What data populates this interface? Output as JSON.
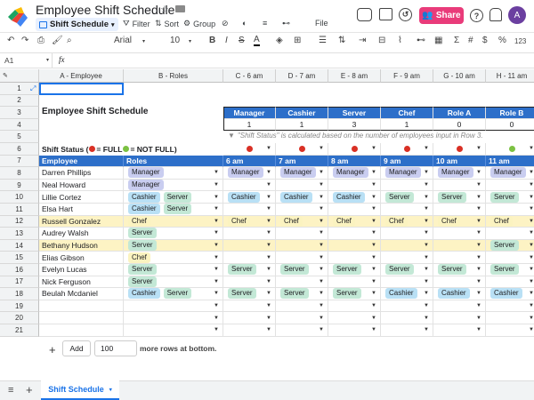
{
  "app": {
    "doc_title": "Employee Shift Schedule",
    "view_name": "Shift Schedule",
    "menu": {
      "filter": "Filter",
      "sort": "Sort",
      "group": "Group",
      "file": "File"
    },
    "share_label": "Share",
    "avatar_initial": "A"
  },
  "toolbar": {
    "font": "Arial",
    "font_size": "10",
    "percent": "%",
    "dollar": "$",
    "format_more": "123"
  },
  "formula_bar": {
    "cell_ref": "A1",
    "fx": "fx"
  },
  "columns": [
    "A - Employee",
    "B - Roles",
    "C - 6 am",
    "D - 7 am",
    "E - 8 am",
    "F - 9 am",
    "G - 10 am",
    "H - 11 am"
  ],
  "rows": [
    "1",
    "2",
    "3",
    "4",
    "5",
    "6",
    "7",
    "8",
    "9",
    "10",
    "11",
    "12",
    "13",
    "14",
    "15",
    "16",
    "17",
    "18",
    "19",
    "20",
    "21"
  ],
  "sheet": {
    "title": "Employee Shift Schedule",
    "summary_headers": [
      "Manager",
      "Cashier",
      "Server",
      "Chef",
      "Role A",
      "Role B"
    ],
    "summary_values": [
      "1",
      "1",
      "3",
      "1",
      "0",
      "0"
    ],
    "note": "\"Shift Status\" is calculated based on the number of employees input in Row 3.",
    "note_marker": "▼",
    "status_label": "Shift Status (",
    "status_full": " = FULL ",
    "status_notfull": " = NOT FULL)",
    "status_dots": [
      "red",
      "red",
      "red",
      "red",
      "red",
      "green"
    ],
    "header_employee": "Employee",
    "header_roles": "Roles",
    "time_headers": [
      "6 am",
      "7 am",
      "8 am",
      "9 am",
      "10 am",
      "11 am"
    ]
  },
  "employees": [
    {
      "name": "Darren Phillips",
      "roles": [
        "Manager"
      ],
      "shifts": [
        "Manager",
        "Manager",
        "Manager",
        "Manager",
        "Manager",
        "Manager"
      ],
      "hl": false
    },
    {
      "name": "Neal Howard",
      "roles": [
        "Manager"
      ],
      "shifts": [
        "",
        "",
        "",
        "",
        "",
        ""
      ],
      "hl": false
    },
    {
      "name": "Lillie Cortez",
      "roles": [
        "Cashier",
        "Server"
      ],
      "shifts": [
        "Cashier",
        "Cashier",
        "Cashier",
        "Server",
        "Server",
        "Server"
      ],
      "hl": false
    },
    {
      "name": "Elsa Hart",
      "roles": [
        "Cashier",
        "Server"
      ],
      "shifts": [
        "",
        "",
        "",
        "",
        "",
        ""
      ],
      "hl": false
    },
    {
      "name": "Russell Gonzalez",
      "roles": [
        "Chef"
      ],
      "shifts": [
        "Chef",
        "Chef",
        "Chef",
        "Chef",
        "Chef",
        "Chef"
      ],
      "hl": true
    },
    {
      "name": "Audrey Walsh",
      "roles": [
        "Server"
      ],
      "shifts": [
        "",
        "",
        "",
        "",
        "",
        ""
      ],
      "hl": false
    },
    {
      "name": "Bethany Hudson",
      "roles": [
        "Server"
      ],
      "shifts": [
        "",
        "",
        "",
        "",
        "",
        "Server"
      ],
      "hl": true
    },
    {
      "name": "Elias Gibson",
      "roles": [
        "Chef"
      ],
      "shifts": [
        "",
        "",
        "",
        "",
        "",
        ""
      ],
      "hl": false
    },
    {
      "name": "Evelyn Lucas",
      "roles": [
        "Server"
      ],
      "shifts": [
        "Server",
        "Server",
        "Server",
        "Server",
        "Server",
        "Server"
      ],
      "hl": false
    },
    {
      "name": "Nick Ferguson",
      "roles": [
        "Server"
      ],
      "shifts": [
        "",
        "",
        "",
        "",
        "",
        ""
      ],
      "hl": false
    },
    {
      "name": "Beulah Mcdaniel",
      "roles": [
        "Cashier",
        "Server"
      ],
      "shifts": [
        "Server",
        "Server",
        "Server",
        "Cashier",
        "Cashier",
        "Cashier"
      ],
      "hl": false
    },
    {
      "name": "",
      "roles": [],
      "shifts": [
        "",
        "",
        "",
        "",
        "",
        ""
      ],
      "hl": false
    },
    {
      "name": "",
      "roles": [],
      "shifts": [
        "",
        "",
        "",
        "",
        "",
        ""
      ],
      "hl": false
    },
    {
      "name": "",
      "roles": [],
      "shifts": [
        "",
        "",
        "",
        "",
        "",
        ""
      ],
      "hl": false
    }
  ],
  "role_colors": {
    "Manager": "#c9cdf0",
    "Cashier": "#b9e0f5",
    "Server": "#c3e8d6",
    "Chef": "#fbf3c0"
  },
  "bottom": {
    "add_label": "Add",
    "rows_value": "100",
    "more_text": "more rows at bottom.",
    "sheet_tab": "Shift Schedule"
  }
}
